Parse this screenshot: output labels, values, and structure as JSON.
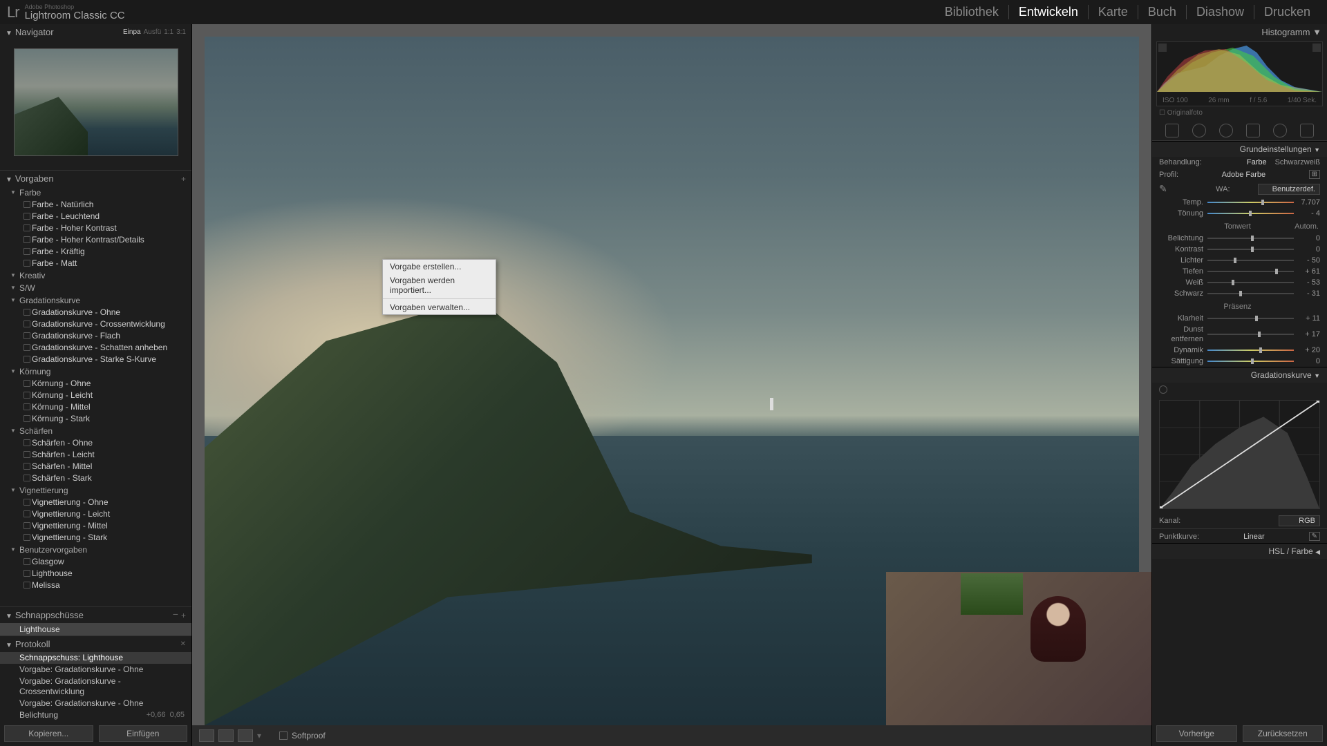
{
  "app": {
    "brand_small": "Adobe Photoshop",
    "brand_big": "Lightroom Classic CC",
    "logo": "Lr"
  },
  "modules": {
    "library": "Bibliothek",
    "develop": "Entwickeln",
    "map": "Karte",
    "book": "Buch",
    "slideshow": "Diashow",
    "print": "Drucken"
  },
  "navigator": {
    "title": "Navigator",
    "zoom": {
      "fit": "Einpa",
      "fill": "Ausfü",
      "one": "1:1",
      "custom": "3:1"
    }
  },
  "presets": {
    "title": "Vorgaben",
    "groups": [
      {
        "name": "Farbe",
        "items": [
          "Farbe - Natürlich",
          "Farbe - Leuchtend",
          "Farbe - Hoher Kontrast",
          "Farbe - Hoher Kontrast/Details",
          "Farbe - Kräftig",
          "Farbe - Matt"
        ]
      },
      {
        "name": "Kreativ",
        "items": []
      },
      {
        "name": "S/W",
        "items": []
      },
      {
        "name": "Gradationskurve",
        "items": [
          "Gradationskurve - Ohne",
          "Gradationskurve - Crossentwicklung",
          "Gradationskurve - Flach",
          "Gradationskurve - Schatten anheben",
          "Gradationskurve - Starke S-Kurve"
        ]
      },
      {
        "name": "Körnung",
        "items": [
          "Körnung - Ohne",
          "Körnung - Leicht",
          "Körnung - Mittel",
          "Körnung - Stark"
        ]
      },
      {
        "name": "Schärfen",
        "items": [
          "Schärfen - Ohne",
          "Schärfen - Leicht",
          "Schärfen - Mittel",
          "Schärfen - Stark"
        ]
      },
      {
        "name": "Vignettierung",
        "items": [
          "Vignettierung - Ohne",
          "Vignettierung - Leicht",
          "Vignettierung - Mittel",
          "Vignettierung - Stark"
        ]
      },
      {
        "name": "Benutzervorgaben",
        "items": [
          "Glasgow",
          "Lighthouse",
          "Melissa"
        ]
      }
    ]
  },
  "snapshots": {
    "title": "Schnappschüsse",
    "items": [
      "Lighthouse"
    ]
  },
  "history": {
    "title": "Protokoll",
    "items": [
      "Schnappschuss: Lighthouse",
      "Vorgabe: Gradationskurve - Ohne",
      "Vorgabe: Gradationskurve - Crossentwicklung",
      "Vorgabe: Gradationskurve - Ohne"
    ],
    "last_label": "Belichtung",
    "last_from": "+0,66",
    "last_to": "0,65"
  },
  "left_footer": {
    "copy": "Kopieren...",
    "paste": "Einfügen"
  },
  "toolbar": {
    "softproof": "Softproof"
  },
  "context_menu": {
    "create": "Vorgabe erstellen...",
    "import": "Vorgaben werden importiert...",
    "manage": "Vorgaben verwalten..."
  },
  "histogram": {
    "title": "Histogramm",
    "iso": "ISO 100",
    "focal": "26 mm",
    "aperture": "f / 5.6",
    "shutter": "1/40 Sek.",
    "original": "Originalfoto"
  },
  "basic": {
    "title": "Grundeinstellungen",
    "treatment": "Behandlung:",
    "color": "Farbe",
    "bw": "Schwarzweiß",
    "profile_label": "Profil:",
    "profile": "Adobe Farbe",
    "wb_label": "WA:",
    "wb_value": "Benutzerdef.",
    "sliders": {
      "temp": {
        "label": "Temp.",
        "value": "7.707",
        "pos": 62
      },
      "tint": {
        "label": "Tönung",
        "value": "- 4",
        "pos": 48
      },
      "tone_hdr": "Tonwert",
      "auto": "Autom.",
      "exposure": {
        "label": "Belichtung",
        "value": "0",
        "pos": 50
      },
      "contrast": {
        "label": "Kontrast",
        "value": "0",
        "pos": 50
      },
      "highlights": {
        "label": "Lichter",
        "value": "- 50",
        "pos": 30
      },
      "shadows": {
        "label": "Tiefen",
        "value": "+ 61",
        "pos": 78
      },
      "whites": {
        "label": "Weiß",
        "value": "- 53",
        "pos": 28
      },
      "blacks": {
        "label": "Schwarz",
        "value": "- 31",
        "pos": 37
      },
      "presence_hdr": "Präsenz",
      "clarity": {
        "label": "Klarheit",
        "value": "+ 11",
        "pos": 55
      },
      "dehaze": {
        "label": "Dunst entfernen",
        "value": "+ 17",
        "pos": 58
      },
      "vibrance": {
        "label": "Dynamik",
        "value": "+ 20",
        "pos": 60
      },
      "saturation": {
        "label": "Sättigung",
        "value": "0",
        "pos": 50
      }
    }
  },
  "tonecurve": {
    "title": "Gradationskurve",
    "channel_label": "Kanal:",
    "channel": "RGB",
    "pointcurve_label": "Punktkurve:",
    "pointcurve": "Linear"
  },
  "hsl": {
    "title": "HSL / Farbe"
  },
  "right_footer": {
    "prev": "Vorherige",
    "reset": "Zurücksetzen"
  }
}
